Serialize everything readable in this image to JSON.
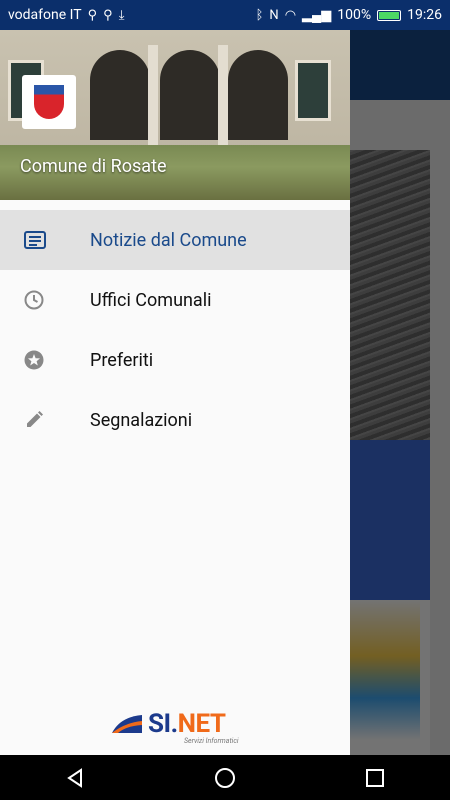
{
  "status_bar": {
    "carrier": "vodafone IT",
    "battery": "100%",
    "time": "19:26"
  },
  "drawer": {
    "header_title": "Comune di Rosate",
    "items": [
      {
        "label": "Notizie dal Comune",
        "icon": "news-icon",
        "active": true
      },
      {
        "label": "Uffici Comunali",
        "icon": "clock-icon",
        "active": false
      },
      {
        "label": "Preferiti",
        "icon": "star-icon",
        "active": false
      },
      {
        "label": "Segnalazioni",
        "icon": "pencil-icon",
        "active": false
      }
    ]
  },
  "brand": {
    "name_part1": "SI.",
    "name_part2": "NET",
    "subtitle": "Servizi Informatici"
  },
  "colors": {
    "primary": "#1a4a8b",
    "status_bar": "#0b2f6b",
    "brand_orange": "#f06a1a"
  }
}
